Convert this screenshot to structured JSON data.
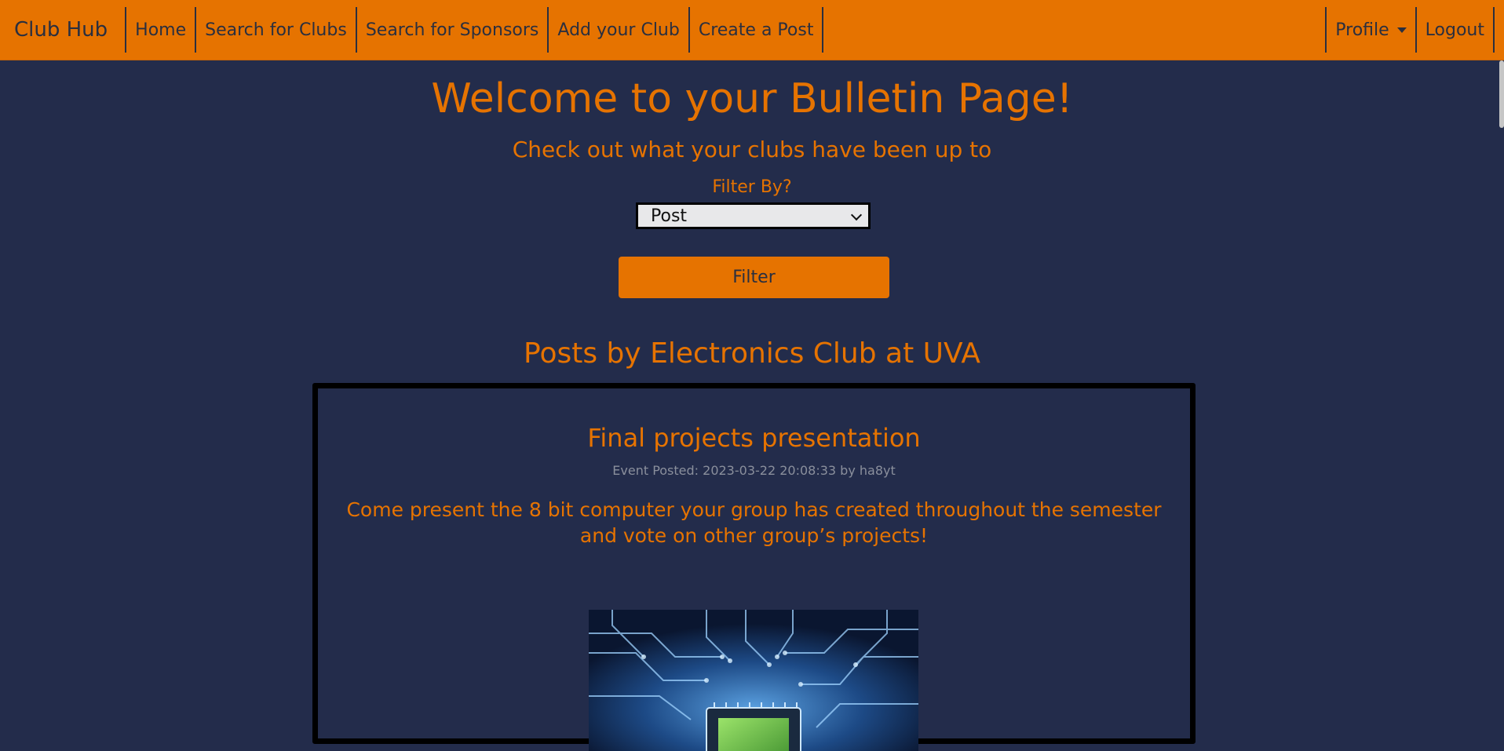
{
  "nav": {
    "brand": "Club Hub",
    "links": [
      "Home",
      "Search for Clubs",
      "Search for Sponsors",
      "Add your Club",
      "Create a Post"
    ],
    "profile": "Profile",
    "logout": "Logout"
  },
  "main": {
    "title": "Welcome to your Bulletin Page!",
    "subtitle": "Check out what your clubs have been up to",
    "filter_label": "Filter By?",
    "filter_selected": "Post",
    "filter_button": "Filter",
    "section_heading": "Posts by Electronics Club at UVA"
  },
  "post": {
    "title": "Final projects presentation",
    "meta": "Event Posted: 2023-03-22 20:08:33 by ha8yt",
    "body": "Come present the 8 bit computer your group has created throughout the semester and vote on other group’s projects!",
    "image_icon": "circuit-board-image"
  },
  "colors": {
    "accent": "#e67300",
    "background": "#232c4b",
    "nav_text": "#2a2f3f",
    "meta_text": "#8a8f9c"
  }
}
